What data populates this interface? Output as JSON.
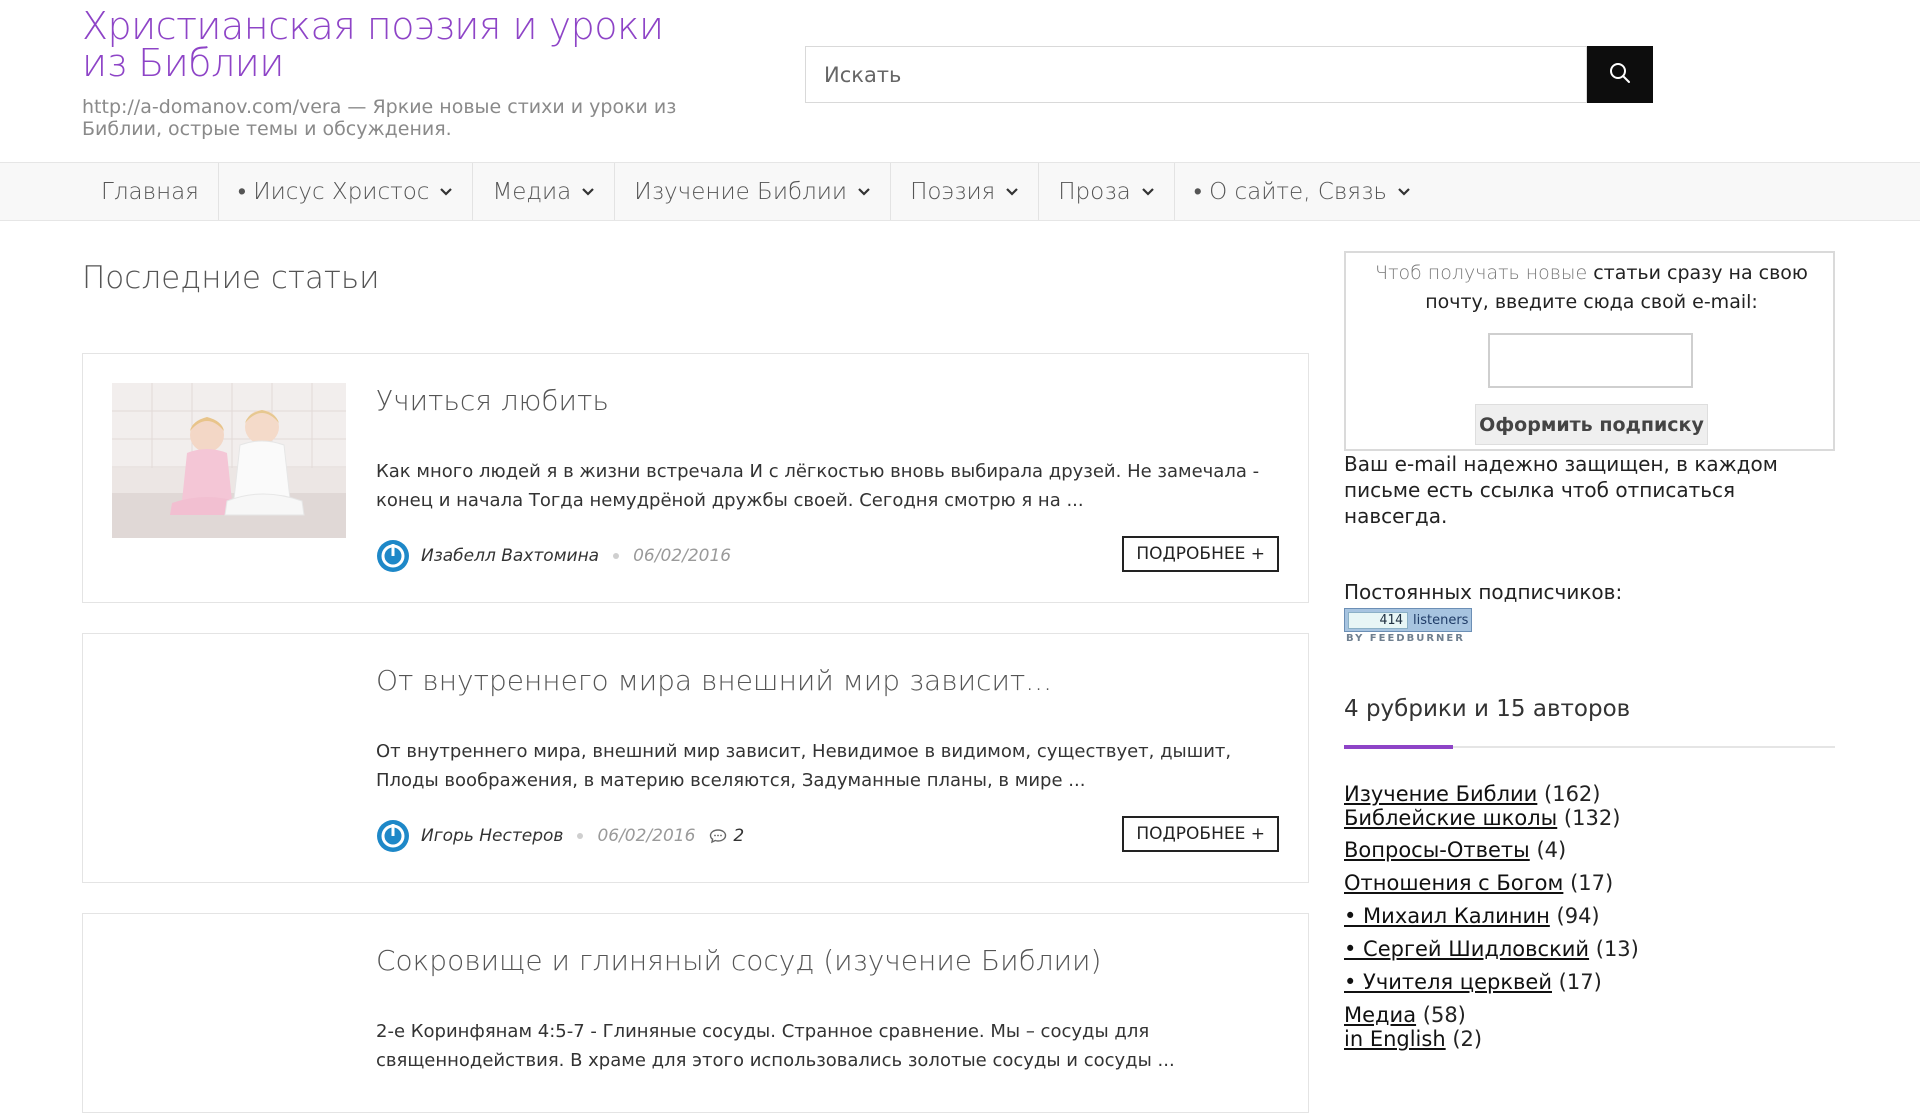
{
  "site": {
    "title": "Христианская поэзия и уроки из Библии",
    "description": "http://a-domanov.com/vera — Яркие новые стихи и уроки из Библии, острые темы и обсуждения."
  },
  "search": {
    "placeholder": "Искать",
    "button_icon": "search-icon"
  },
  "nav": {
    "items": [
      {
        "label": "Главная",
        "dropdown": false
      },
      {
        "label": "• Иисус Христос",
        "dropdown": true
      },
      {
        "label": "Медиа",
        "dropdown": true
      },
      {
        "label": "Изучение Библии",
        "dropdown": true
      },
      {
        "label": "Поэзия",
        "dropdown": true
      },
      {
        "label": "Проза",
        "dropdown": true
      },
      {
        "label": "• О сайте, Связь",
        "dropdown": true
      }
    ]
  },
  "main": {
    "section_title": "Последние статьи",
    "posts": [
      {
        "title": "Учиться любить",
        "excerpt": "Как много людей я в жизни встречала И с лёгкостью вновь выбирала друзей. Не замечала - конец и начала Тогда немудрёной дружбы своей. Сегодня смотрю я на ...",
        "author": "Изабелл Вахтомина",
        "date": "06/02/2016",
        "comments": "",
        "more_label": "ПОДРОБНЕЕ +",
        "has_thumbnail": true
      },
      {
        "title": "От внутреннего мира внешний мир зависит...",
        "excerpt": "От внутреннего мира, внешний мир зависит, Невидимое в видимом, существует, дышит, Плоды воображения, в материю вселяются, Задуманные планы, в мире ...",
        "author": "Игорь Нестеров",
        "date": "06/02/2016",
        "comments": "2",
        "more_label": "ПОДРОБНЕЕ +",
        "has_thumbnail": false
      },
      {
        "title": "Сокровище и глиняный сосуд (изучение Библии)",
        "excerpt": "2-е Коринфянам 4:5-7 - Глиняные сосуды. Странное сравнение. Мы – сосуды для священнодействия. В храме для этого использовались золотые сосуды и сосуды ...",
        "author": "",
        "date": "",
        "comments": "",
        "more_label": "",
        "has_thumbnail": false
      }
    ]
  },
  "sidebar": {
    "subscribe": {
      "intro_light": "Чтоб получать новые",
      "intro_bold": " статьи сразу на свою почту, введите сюда свой e-mail:",
      "email_value": "",
      "button_label": "Оформить подписку",
      "note": "Ваш e-mail надежно защищен, в каждом письме есть ссылка чтоб отписаться навсегда."
    },
    "subscribers": {
      "label": "Постоянных подписчиков:",
      "count": "414",
      "unit": "listeners",
      "by": "BY FEEDBURNER"
    },
    "categories": {
      "title": "4 рубрики и 15 авторов",
      "items": [
        {
          "name": "Изучение Библии",
          "count": "(162)"
        },
        {
          "name": "Библейские школы",
          "count": "(132)"
        },
        {
          "name": "Вопросы-Ответы",
          "count": "(4)"
        },
        {
          "name": "Отношения с Богом",
          "count": "(17)"
        },
        {
          "name": "• Михаил Калинин",
          "count": "(94)"
        },
        {
          "name": "• Сергей Шидловский",
          "count": "(13)"
        },
        {
          "name": "• Учителя церквей",
          "count": "(17)"
        },
        {
          "name": "Медиа",
          "count": "(58)"
        },
        {
          "name": "in English",
          "count": "(2)"
        }
      ]
    }
  },
  "colors": {
    "accent": "#8e44c7",
    "avatar_blue": "#1e88c8",
    "search_button": "#0d0d0d"
  }
}
